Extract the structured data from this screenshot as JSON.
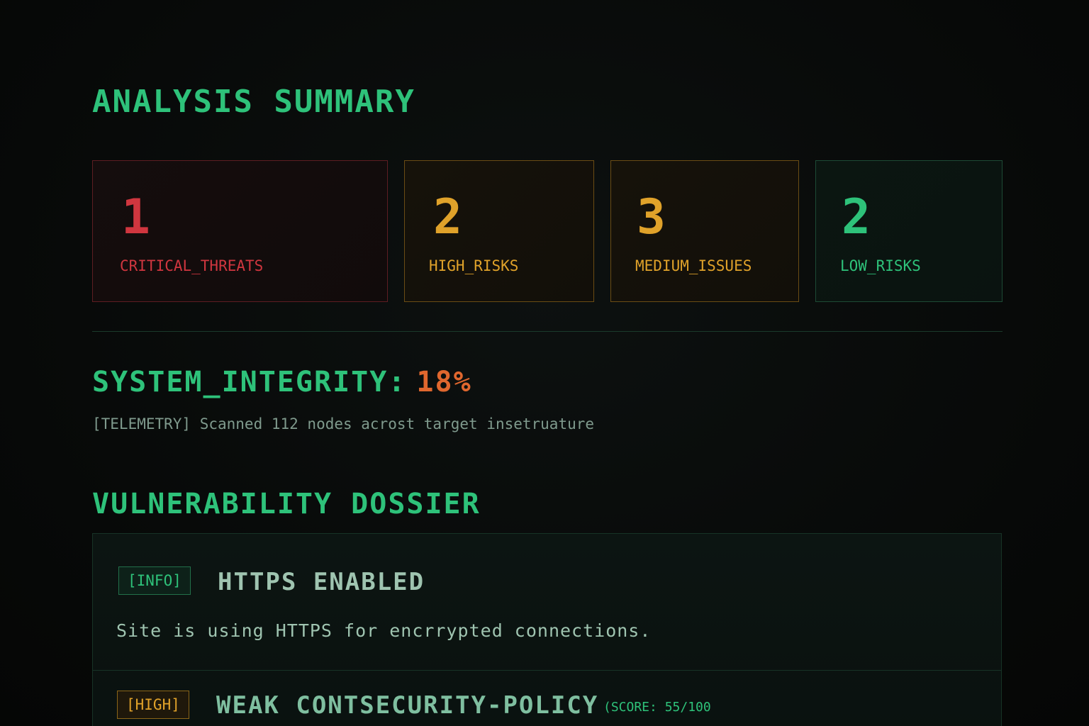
{
  "summary": {
    "title": "ANALYSIS SUMMARY",
    "cards": [
      {
        "count": "1",
        "label": "CRITICAL_THREATS",
        "color": "#d0363f"
      },
      {
        "count": "2",
        "label": "HIGH_RISKS",
        "color": "#e0a22a"
      },
      {
        "count": "3",
        "label": "MEDIUM_ISSUES",
        "color": "#e0a22a"
      },
      {
        "count": "2",
        "label": "LOW_RISKS",
        "color": "#2ec27a"
      }
    ]
  },
  "integrity": {
    "label": "SYSTEM_INTEGRITY:",
    "value": "18%",
    "telemetry": "[TELEMETRY] Scanned 112 nodes acrost target insetruature"
  },
  "dossier": {
    "title": "VULNERABILITY DOSSIER",
    "entries": [
      {
        "badge": "[INFO]",
        "title": "HTTPS ENABLED",
        "description": "Site is using HTTPS for encrrypted connections."
      },
      {
        "badge": "[HIGH]",
        "title": "WEAK CONTSECURITY-POLICY",
        "score": "(SCORE: 55/100"
      }
    ]
  },
  "colors": {
    "accent": "#2ec27a",
    "critical": "#d0363f",
    "warning": "#e0a22a",
    "integrity_value": "#e0672e",
    "background": "#080a09"
  }
}
